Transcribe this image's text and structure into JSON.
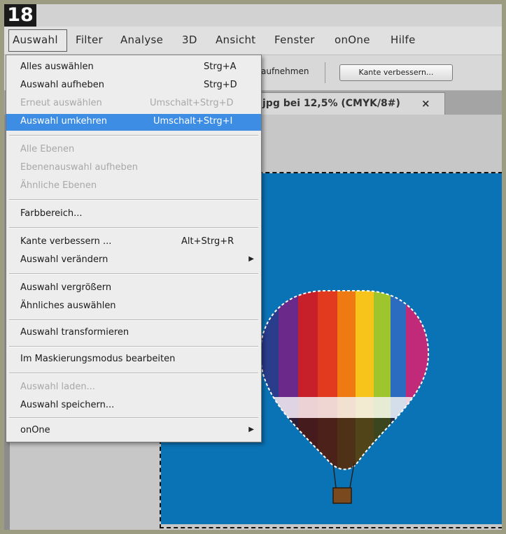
{
  "step_number": "18",
  "menubar": {
    "items": [
      "Auswahl",
      "Filter",
      "Analyse",
      "3D",
      "Ansicht",
      "Fenster",
      "onOne",
      "Hilfe"
    ]
  },
  "options_bar": {
    "label": "aufnehmen",
    "button": "Kante verbessern..."
  },
  "document_tab": {
    "title": "jpg bei 12,5% (CMYK/8#)",
    "close": "×"
  },
  "menu": {
    "items": [
      {
        "label": "Alles auswählen",
        "shortcut": "Strg+A",
        "disabled": false
      },
      {
        "label": "Auswahl aufheben",
        "shortcut": "Strg+D",
        "disabled": false
      },
      {
        "label": "Erneut auswählen",
        "shortcut": "Umschalt+Strg+D",
        "disabled": true
      },
      {
        "label": "Auswahl umkehren",
        "shortcut": "Umschalt+Strg+I",
        "disabled": false,
        "highlighted": true
      },
      {
        "label": "Alle Ebenen",
        "shortcut": "",
        "disabled": true
      },
      {
        "label": "Ebenenauswahl aufheben",
        "shortcut": "",
        "disabled": true
      },
      {
        "label": "Ähnliche Ebenen",
        "shortcut": "",
        "disabled": true
      },
      {
        "label": "Farbbereich...",
        "shortcut": "",
        "disabled": false
      },
      {
        "label": "Kante verbessern ...",
        "shortcut": "Alt+Strg+R",
        "disabled": false
      },
      {
        "label": "Auswahl verändern",
        "shortcut": "",
        "disabled": false,
        "submenu": true
      },
      {
        "label": "Auswahl vergrößern",
        "shortcut": "",
        "disabled": false
      },
      {
        "label": "Ähnliches auswählen",
        "shortcut": "",
        "disabled": false
      },
      {
        "label": "Auswahl transformieren",
        "shortcut": "",
        "disabled": false
      },
      {
        "label": "Im Maskierungsmodus bearbeiten",
        "shortcut": "",
        "disabled": false
      },
      {
        "label": "Auswahl laden...",
        "shortcut": "",
        "disabled": true
      },
      {
        "label": "Auswahl speichern...",
        "shortcut": "",
        "disabled": false
      },
      {
        "label": "onOne",
        "shortcut": "",
        "disabled": false,
        "submenu": true
      }
    ],
    "submenu_arrow": "▶"
  },
  "colors": {
    "highlight": "#3e8de4",
    "sky": "#0a73b6"
  }
}
